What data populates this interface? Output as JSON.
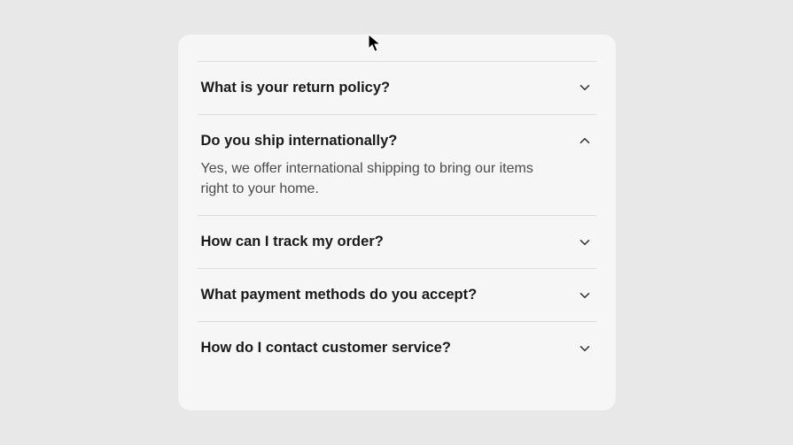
{
  "faq": {
    "items": [
      {
        "question": "What is your return policy?",
        "expanded": false
      },
      {
        "question": "Do you ship internationally?",
        "expanded": true,
        "answer": "Yes, we offer international shipping to bring our items right to your home."
      },
      {
        "question": "How can I track my order?",
        "expanded": false
      },
      {
        "question": "What payment methods do you accept?",
        "expanded": false
      },
      {
        "question": "How do I contact customer service?",
        "expanded": false
      }
    ]
  }
}
